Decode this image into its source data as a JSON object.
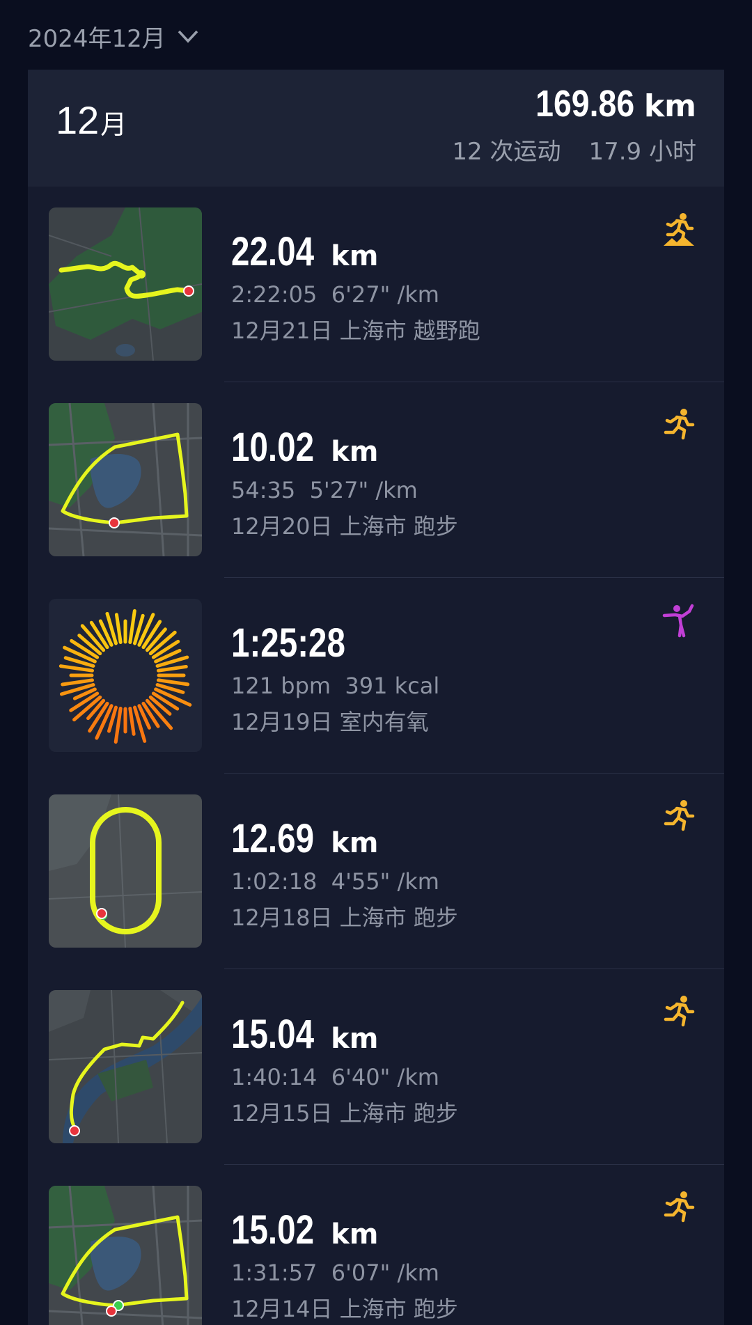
{
  "header": {
    "month_selector": "2024年12月"
  },
  "summary": {
    "month_num": "12",
    "month_unit": "月",
    "total_distance": "169.86",
    "distance_unit": "km",
    "workout_count": "12 次运动",
    "total_hours": "17.9 小时"
  },
  "activities": [
    {
      "primary": "22.04",
      "unit": "km",
      "line2": "2:22:05  6'27\" /km",
      "line3": "12月21日 上海市 越野跑",
      "icon": "trail-run-icon"
    },
    {
      "primary": "10.02",
      "unit": "km",
      "line2": "54:35  5'27\" /km",
      "line3": "12月20日 上海市 跑步",
      "icon": "run-icon"
    },
    {
      "primary": "1:25:28",
      "unit": "",
      "line2": "121 bpm  391 kcal",
      "line3": "12月19日 室内有氧",
      "icon": "yoga-icon"
    },
    {
      "primary": "12.69",
      "unit": "km",
      "line2": "1:02:18  4'55\" /km",
      "line3": "12月18日 上海市 跑步",
      "icon": "run-icon"
    },
    {
      "primary": "15.04",
      "unit": "km",
      "line2": "1:40:14  6'40\" /km",
      "line3": "12月15日 上海市 跑步",
      "icon": "run-icon"
    },
    {
      "primary": "15.02",
      "unit": "km",
      "line2": "1:31:57  6'07\" /km",
      "line3": "12月14日 上海市 跑步",
      "icon": "run-icon"
    }
  ],
  "colors": {
    "accent_run": "#f5b52e",
    "accent_yoga": "#c13fd6",
    "route": "#e6f51e",
    "background": "#0a0e1f",
    "card": "#161b2e"
  }
}
